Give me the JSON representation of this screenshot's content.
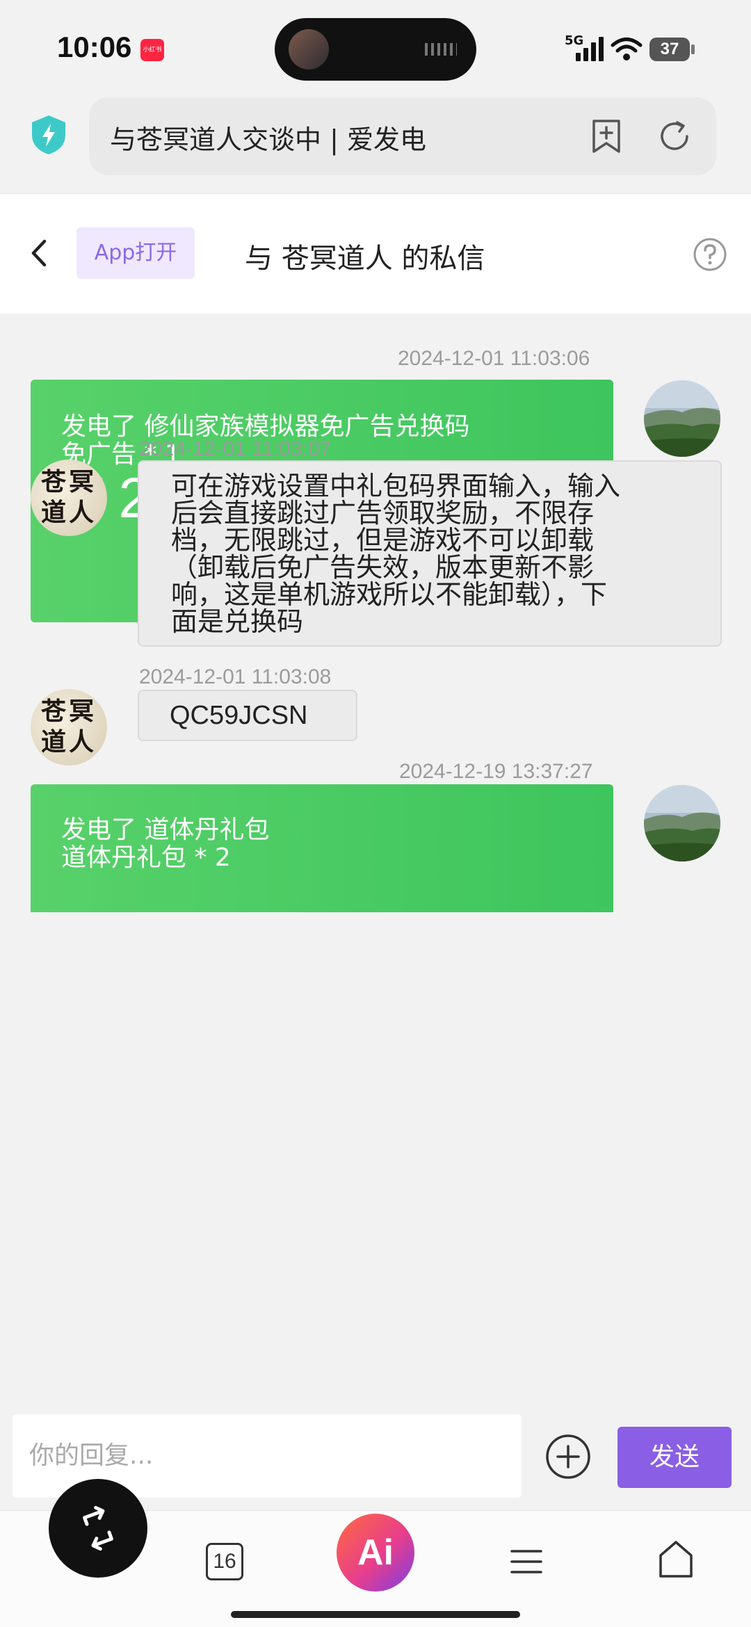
{
  "status_bar": {
    "time": "10:06",
    "app_badge": "小红书",
    "network": "5G",
    "battery": "37"
  },
  "browser": {
    "url_title": "与苍冥道人交谈中 | 爱发电"
  },
  "header": {
    "app_open_label": "App打开",
    "title": "与 苍冥道人 的私信"
  },
  "messages": [
    {
      "timestamp": "2024-12-01 11:03:06",
      "line1": "发电了 修仙家族模拟器免广告兑换码",
      "line2": "免广告 * 1",
      "amount": "¥ 21.00"
    },
    {
      "timestamp": "2024-12-01 11:03:07",
      "avatar_text": "苍冥道人",
      "lines": [
        "可在游戏设置中礼包码界面输入，输入",
        "后会直接跳过广告领取奖励，不限存",
        "档，无限跳过，但是游戏不可以卸载",
        "（卸载后免广告失效，版本更新不影",
        "响，这是单机游戏所以不能卸载），下",
        "面是兑换码"
      ]
    },
    {
      "timestamp": "2024-12-01 11:03:08",
      "avatar_text": "苍冥道人",
      "text": "QC59JCSN"
    },
    {
      "timestamp": "2024-12-19 13:37:27",
      "line1": "发电了 道体丹礼包",
      "line2": "道体丹礼包 * 2"
    }
  ],
  "reply": {
    "placeholder": "你的回复...",
    "send_label": "发送"
  },
  "nav": {
    "tabs_count": "16",
    "ai_label": "Ai"
  },
  "colors": {
    "green_card": "#4cc961",
    "send_purple": "#8a5ee5",
    "app_open_bg": "#efe8ff"
  }
}
